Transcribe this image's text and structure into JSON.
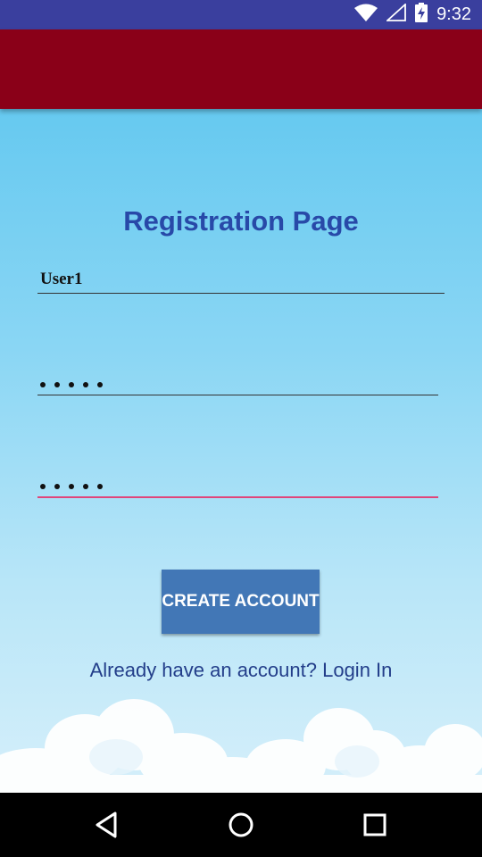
{
  "status_bar": {
    "time": "9:32",
    "icons": [
      "wifi-icon",
      "cell-signal-icon",
      "battery-charging-icon"
    ],
    "color": "#3a3f9e"
  },
  "app_bar": {
    "color": "#8a0018"
  },
  "form": {
    "title": "Registration Page",
    "username_value": "User1",
    "password_dots": 5,
    "confirm_password_dots": 5,
    "create_button_label": "CREATE ACCOUNT",
    "login_link": "Already have an account? Login In"
  },
  "nav_bar": {
    "icons": [
      "back-icon",
      "home-icon",
      "recents-icon"
    ]
  },
  "colors": {
    "title": "#2849a8",
    "button": "#4277b6",
    "focused_underline": "#e0457a"
  }
}
